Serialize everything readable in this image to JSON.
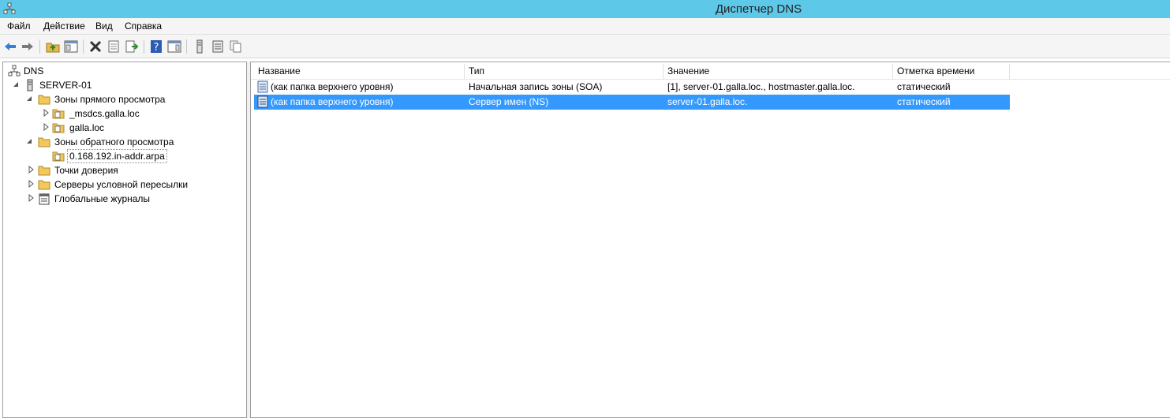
{
  "window": {
    "title": "Диспетчер DNS"
  },
  "menu": [
    "Файл",
    "Действие",
    "Вид",
    "Справка"
  ],
  "toolbar": {
    "icons": [
      "back-icon",
      "forward-icon",
      "up-folder-icon",
      "show-hide-tree-icon",
      "delete-icon",
      "properties-icon",
      "export-list-icon",
      "help-icon",
      "show-action-pane-icon",
      "server-icon",
      "list-icon",
      "copy-icon"
    ]
  },
  "tree": {
    "root": "DNS",
    "server": "SERVER-01",
    "forward_zones": "Зоны прямого просмотра",
    "msdcs": "_msdcs.galla.loc",
    "galla": "galla.loc",
    "reverse_zones": "Зоны обратного просмотра",
    "reverse_zone": "0.168.192.in-addr.arpa",
    "trust_points": "Точки доверия",
    "conditional_forwarders": "Серверы условной пересылки",
    "global_logs": "Глобальные журналы"
  },
  "table": {
    "columns": [
      "Название",
      "Тип",
      "Значение",
      "Отметка времени"
    ],
    "rows": [
      {
        "name": "(как папка верхнего уровня)",
        "type": "Начальная запись зоны (SOA)",
        "value": "[1], server-01.galla.loc., hostmaster.galla.loc.",
        "timestamp": "статический",
        "selected": false
      },
      {
        "name": "(как папка верхнего уровня)",
        "type": "Сервер имен (NS)",
        "value": "server-01.galla.loc.",
        "timestamp": "статический",
        "selected": true
      }
    ]
  },
  "colors": {
    "titlebar": "#5dc8e8",
    "selection": "#3399ff",
    "folder": "#f2c85b"
  }
}
